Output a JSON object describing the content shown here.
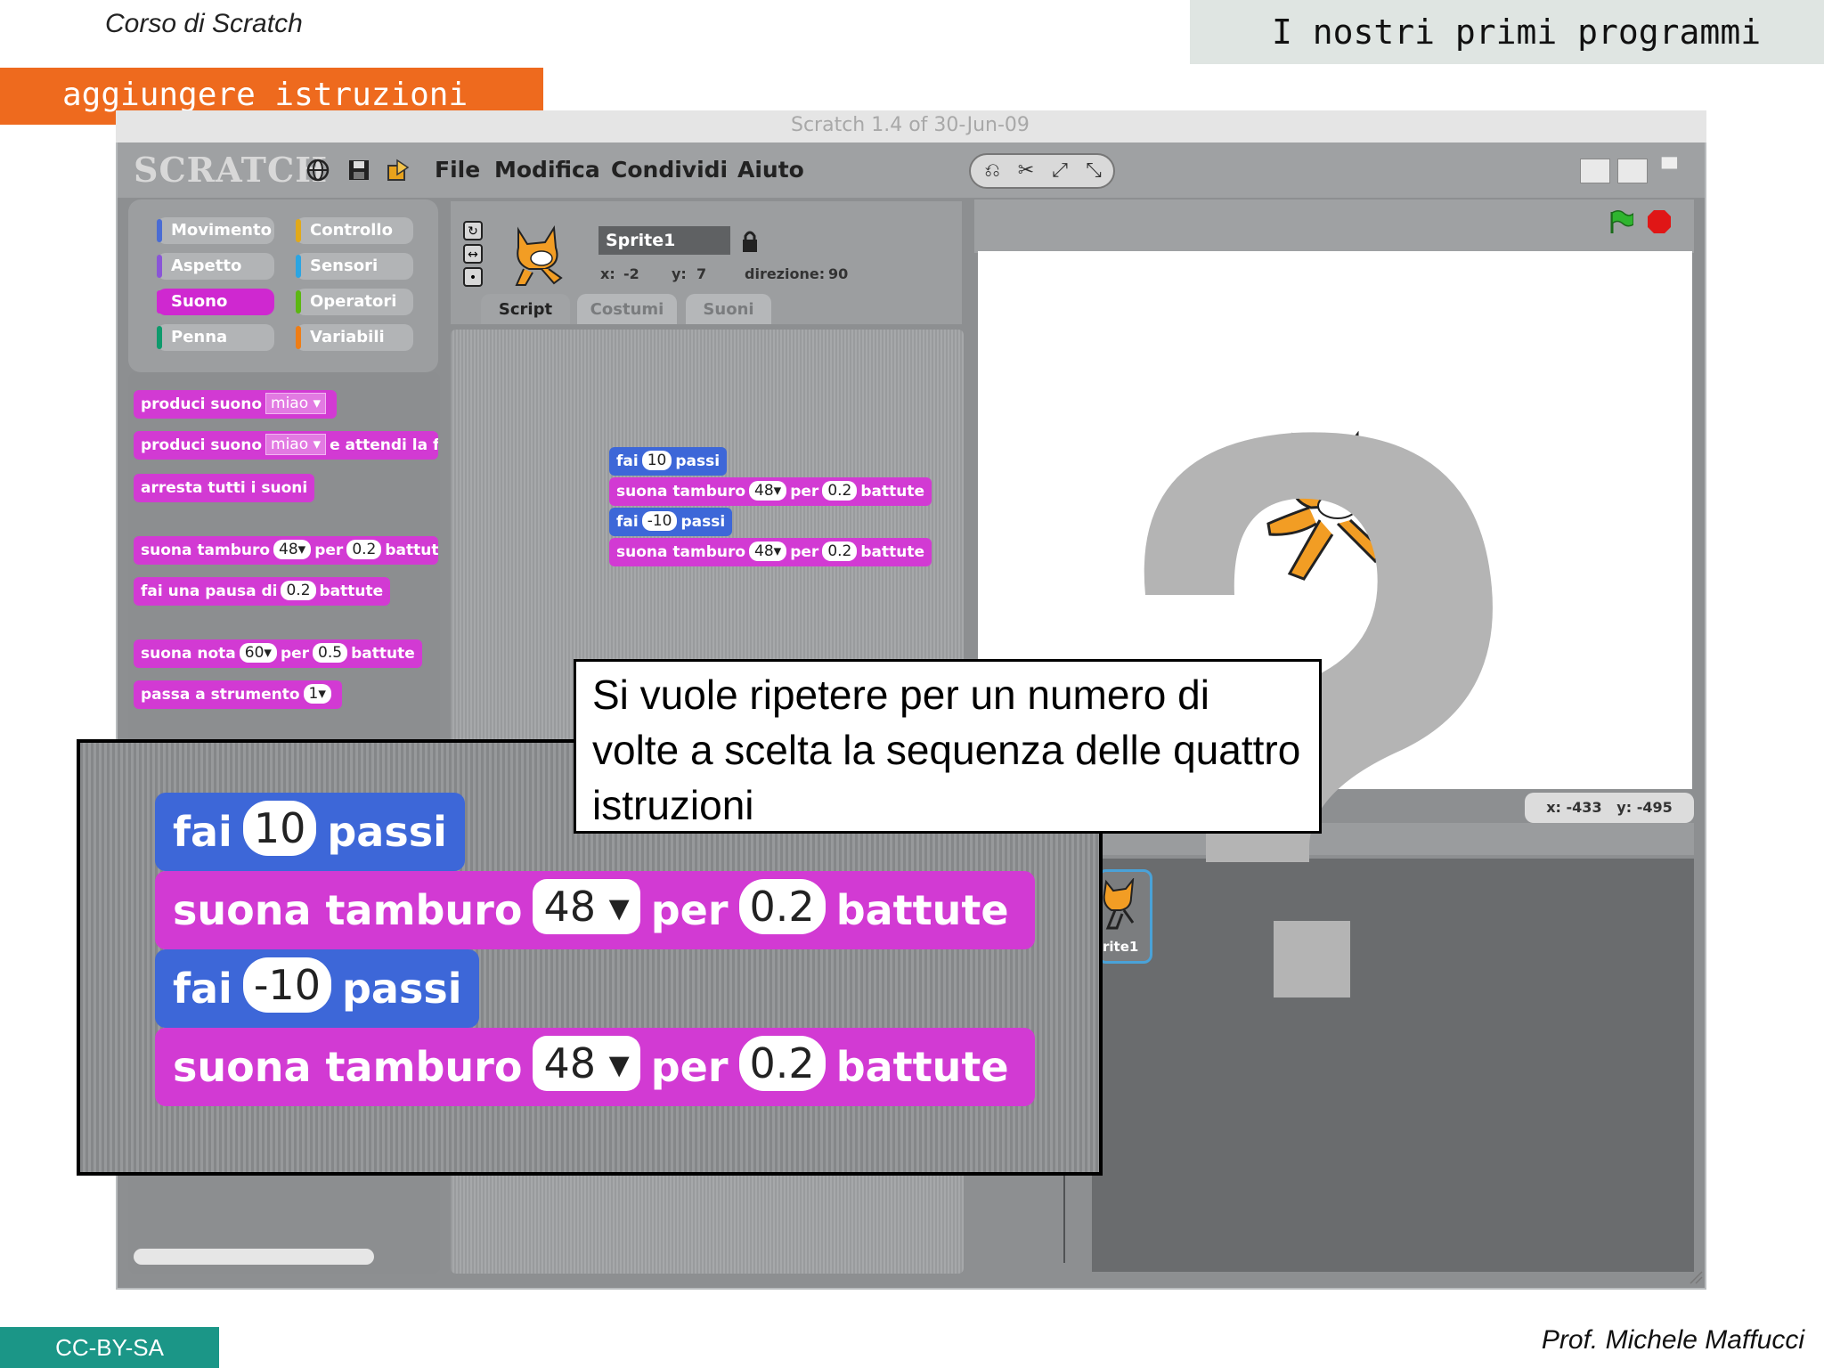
{
  "slide": {
    "course": "Corso di Scratch",
    "topic": "I nostri primi programmi",
    "section": "aggiungere istruzioni",
    "license": "CC-BY-SA",
    "author": "Prof. Michele Maffucci"
  },
  "window": {
    "title": "Scratch 1.4 of 30-Jun-09",
    "logo": "SCRATCH",
    "menu": [
      "File",
      "Modifica",
      "Condividi",
      "Aiuto"
    ]
  },
  "icons": {
    "globe": "globe-icon",
    "save": "save-icon",
    "share": "share-icon",
    "stamp": "stamp-icon",
    "delete": "scissors-icon",
    "grow": "grow-icon",
    "shrink": "shrink-icon",
    "flag": "green-flag-icon",
    "stop": "stop-icon"
  },
  "categories": [
    {
      "label": "Movimento",
      "color": "#4a6cd4"
    },
    {
      "label": "Controllo",
      "color": "#e1a91a"
    },
    {
      "label": "Aspetto",
      "color": "#8a55d7"
    },
    {
      "label": "Sensori",
      "color": "#2ca5e2"
    },
    {
      "label": "Suono",
      "color": "#cf28d0"
    },
    {
      "label": "Operatori",
      "color": "#5cb712"
    },
    {
      "label": "Penna",
      "color": "#0e9a6c"
    },
    {
      "label": "Variabili",
      "color": "#ee7d16"
    }
  ],
  "palette": {
    "play_sound": "produci suono",
    "play_sound_wait": "produci suono",
    "wait_until_done": "e attendi la fine",
    "sound_arg": "miao",
    "stop_sounds": "arresta tutti i suoni",
    "play_drum": "suona tamburo",
    "drum_arg": "48",
    "for": "per",
    "beats_arg": "0.2",
    "beats": "battute",
    "rest_for": "fai una pausa di",
    "rest_arg": "0.2",
    "play_note": "suona nota",
    "note_arg": "60",
    "note_beats_arg": "0.5",
    "set_instrument": "passa a strumento",
    "instrument_arg": "1"
  },
  "sprite": {
    "name": "Sprite1",
    "x_label": "x:",
    "x": "-2",
    "y_label": "y:",
    "y": "7",
    "dir_label": "direzione:",
    "dir": "90"
  },
  "tabs": [
    "Script",
    "Costumi",
    "Suoni"
  ],
  "script": {
    "move": "fai",
    "steps": "passi",
    "move1": "10",
    "move2": "-10",
    "drum": "suona tamburo",
    "drum_arg": "48",
    "per": "per",
    "beats_arg": "0.2",
    "beats": "battute"
  },
  "stage": {
    "x_label": "x:",
    "x": "-433",
    "y_label": "y:",
    "y": "-495",
    "sprite_label": "rite1"
  },
  "callout": "Si vuole ripetere per un numero di volte a scelta la sequenza delle quattro istruzioni",
  "colors": {
    "accent_orange": "#ee6a1e",
    "license_teal": "#1b9687",
    "sound_pink": "#d23ad3",
    "motion_blue": "#3d67d8"
  }
}
